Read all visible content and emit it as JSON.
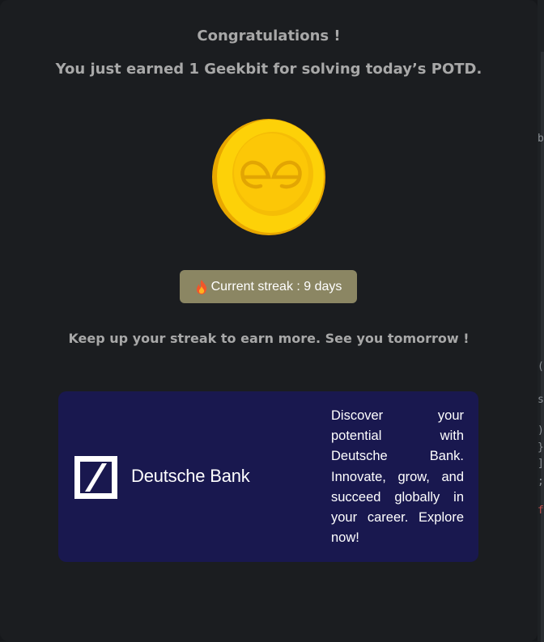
{
  "modal": {
    "title": "Congratulations !",
    "subtitle": "You just earned 1 Geekbit for solving today’s POTD.",
    "coin_icon": "geeksforgeeks-coin-icon",
    "streak": {
      "icon": "fire-icon",
      "label": "Current streak : 9 days"
    },
    "encouragement": "Keep up your streak to earn more. See you tomorrow !"
  },
  "ad": {
    "logo_icon": "deutsche-bank-logo-icon",
    "brand_name": "Deutsche Bank",
    "text": "Discover your potential with Deutsche Bank. Innovate, grow, and succeed globally in your career. Explore now!",
    "background_color": "#19184f"
  },
  "background_edge": {
    "glyphs": [
      "b",
      "(",
      "s",
      ")",
      "}",
      "]",
      ";",
      "f"
    ]
  },
  "colors": {
    "modal_bg": "#1b1d20",
    "text_muted": "#a8a8a8",
    "streak_badge": "#8b8663",
    "coin_gold": "#fdd108"
  }
}
